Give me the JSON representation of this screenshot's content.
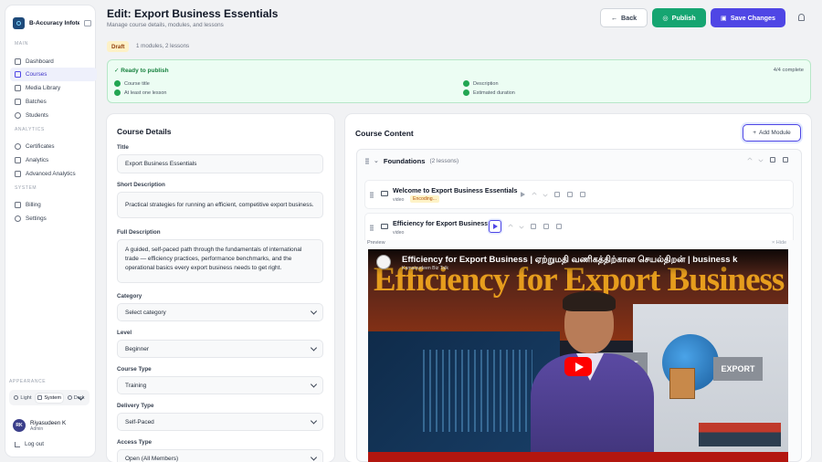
{
  "brand": {
    "name": "B-Accuracy Infote..."
  },
  "sidebar": {
    "main_label": "MAIN",
    "main_items": [
      "Dashboard",
      "Courses",
      "Media Library",
      "Batches",
      "Students"
    ],
    "analytics_label": "ANALYTICS",
    "analytics_items": [
      "Certificates",
      "Analytics",
      "Advanced Analytics"
    ],
    "system_label": "SYSTEM",
    "system_items": [
      "Billing",
      "Settings"
    ],
    "appearance_label": "APPEARANCE",
    "theme": {
      "light": "Light",
      "system": "System",
      "dark": "Dark",
      "selected": "System"
    },
    "user": {
      "initials": "RK",
      "name": "Riyasudeen K",
      "role": "Admin"
    },
    "logout": "Log out"
  },
  "header": {
    "title": "Edit: Export Business Essentials",
    "subtitle": "Manage course details, modules, and lessons",
    "back": "Back",
    "publish": "Publish",
    "save": "Save Changes"
  },
  "status": {
    "badge": "Draft",
    "meta": "1 modules, 2 lessons"
  },
  "ready": {
    "title": "✓ Ready to publish",
    "progress": "4/4 complete",
    "checks": [
      "Course title",
      "At least one lesson",
      "Description",
      "Estimated duration"
    ]
  },
  "details": {
    "heading": "Course Details",
    "title_label": "Title",
    "title_value": "Export Business Essentials",
    "short_label": "Short Description",
    "short_value": "Practical strategies for running an efficient, competitive export business.",
    "full_label": "Full Description",
    "full_value": "A guided, self-paced path through the fundamentals of international trade — efficiency practices, performance benchmarks, and the operational basics every export business needs to get right.",
    "category_label": "Category",
    "category_value": "Select category",
    "level_label": "Level",
    "level_value": "Beginner",
    "type_label": "Course Type",
    "type_value": "Training",
    "delivery_label": "Delivery Type",
    "delivery_value": "Self-Paced",
    "access_label": "Access Type",
    "access_value": "Open (All Members)"
  },
  "content": {
    "heading": "Course Content",
    "add_module": "Add Module",
    "module": {
      "name": "Foundations",
      "count": "(2 lessons)"
    },
    "lessons": [
      {
        "title": "Welcome to Export Business Essentials",
        "type": "video",
        "status": "Encoding..."
      },
      {
        "title": "Efficiency for Export Business",
        "type": "video"
      }
    ],
    "preview_label": "Preview",
    "hide_label": "Hide"
  },
  "video": {
    "title": "Efficiency for Export Business | ஏற்றுமதி வணிகத்திற்கான செயல்திறன் | business k",
    "channel": "Kamalsudeen Biz Talk",
    "overlay_text": "Efficiency for Export Business",
    "import_label": "IMPORT",
    "export_label": "EXPORT"
  },
  "colors": {
    "accent": "#4f46e5",
    "publish": "#16a571",
    "ready_bg": "#ecfdf3",
    "draft_bg": "#fdf1c7"
  }
}
